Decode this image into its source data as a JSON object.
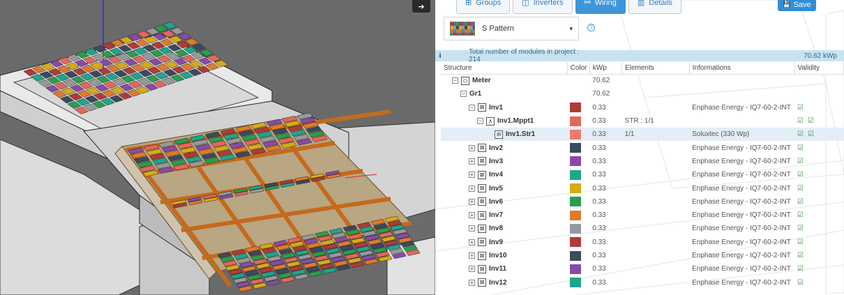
{
  "tabs": [
    {
      "label": "Groups",
      "icon": "groups-icon",
      "glyph": "⊞",
      "active": false
    },
    {
      "label": "Inverters",
      "icon": "inverter-icon",
      "glyph": "◫",
      "active": false
    },
    {
      "label": "Wiring",
      "icon": "wiring-icon",
      "glyph": "⚯",
      "active": true
    },
    {
      "label": "Details",
      "icon": "chart-icon",
      "glyph": "▥",
      "active": false
    }
  ],
  "toolbar": {
    "save_label": "Save",
    "save_icon": "💾"
  },
  "pattern": {
    "label": "S Pattern",
    "help": "?"
  },
  "info": {
    "icon": "i",
    "text": "Total number of modules in project : 214",
    "kwp": "70.62 kWp"
  },
  "columns": [
    "Structure",
    "Color",
    "kWp",
    "Elements",
    "Informations",
    "Validity"
  ],
  "rows": [
    {
      "indent": 1,
      "exp": "⊟",
      "icon": "meter-icon",
      "iconGlyph": "▭",
      "name": "Meter",
      "color": "",
      "kwp": "70.62",
      "elements": "",
      "info": "",
      "valid": 0,
      "sel": false
    },
    {
      "indent": 2,
      "exp": "⊟",
      "icon": "",
      "iconGlyph": "",
      "name": "Gr1",
      "color": "",
      "kwp": "70.62",
      "elements": "",
      "info": "",
      "valid": 0,
      "sel": false
    },
    {
      "indent": 3,
      "exp": "⊟",
      "icon": "inverter-icon",
      "iconGlyph": "⊠",
      "name": "Inv1",
      "color": "#b23a36",
      "kwp": "0.33",
      "elements": "",
      "info": "Enphase Energy - IQ7-60-2-INT",
      "valid": 1,
      "sel": false
    },
    {
      "indent": 4,
      "exp": "⊟",
      "icon": "mppt-icon",
      "iconGlyph": "∧",
      "name": "Inv1.Mppt1",
      "color": "#e5665c",
      "kwp": "0.33",
      "elements": "STR : 1/1",
      "info": "",
      "valid": 2,
      "sel": false
    },
    {
      "indent": 5,
      "exp": "",
      "icon": "string-icon",
      "iconGlyph": "⊞",
      "name": "Inv1.Str1",
      "color": "#ee7b72",
      "kwp": "0.33",
      "elements": "1/1",
      "info": "Soluxtec (330 Wp)",
      "valid": 2,
      "sel": true
    },
    {
      "indent": 3,
      "exp": "⊞",
      "icon": "inverter-icon",
      "iconGlyph": "⊠",
      "name": "Inv2",
      "color": "#3b4a5e",
      "kwp": "0.33",
      "elements": "",
      "info": "Enphase Energy - IQ7-60-2-INT",
      "valid": 1,
      "sel": false
    },
    {
      "indent": 3,
      "exp": "⊞",
      "icon": "inverter-icon",
      "iconGlyph": "⊠",
      "name": "Inv3",
      "color": "#8a4aa8",
      "kwp": "0.33",
      "elements": "",
      "info": "Enphase Energy - IQ7-60-2-INT",
      "valid": 1,
      "sel": false
    },
    {
      "indent": 3,
      "exp": "⊞",
      "icon": "inverter-icon",
      "iconGlyph": "⊠",
      "name": "Inv4",
      "color": "#1fa58e",
      "kwp": "0.33",
      "elements": "",
      "info": "Enphase Energy - IQ7-60-2-INT",
      "valid": 1,
      "sel": false
    },
    {
      "indent": 3,
      "exp": "⊞",
      "icon": "inverter-icon",
      "iconGlyph": "⊠",
      "name": "Inv5",
      "color": "#d8ab12",
      "kwp": "0.33",
      "elements": "",
      "info": "Enphase Energy - IQ7-60-2-INT",
      "valid": 1,
      "sel": false
    },
    {
      "indent": 3,
      "exp": "⊞",
      "icon": "inverter-icon",
      "iconGlyph": "⊠",
      "name": "Inv6",
      "color": "#2a9e4c",
      "kwp": "0.33",
      "elements": "",
      "info": "Enphase Energy - IQ7-60-2-INT",
      "valid": 1,
      "sel": false
    },
    {
      "indent": 3,
      "exp": "⊞",
      "icon": "inverter-icon",
      "iconGlyph": "⊠",
      "name": "Inv7",
      "color": "#e07a2a",
      "kwp": "0.33",
      "elements": "",
      "info": "Enphase Energy - IQ7-60-2-INT",
      "valid": 1,
      "sel": false
    },
    {
      "indent": 3,
      "exp": "⊞",
      "icon": "inverter-icon",
      "iconGlyph": "⊠",
      "name": "Inv8",
      "color": "#969a9b",
      "kwp": "0.33",
      "elements": "",
      "info": "Enphase Energy - IQ7-60-2-INT",
      "valid": 1,
      "sel": false
    },
    {
      "indent": 3,
      "exp": "⊞",
      "icon": "inverter-icon",
      "iconGlyph": "⊠",
      "name": "Inv9",
      "color": "#b23a36",
      "kwp": "0.33",
      "elements": "",
      "info": "Enphase Energy - IQ7-60-2-INT",
      "valid": 1,
      "sel": false
    },
    {
      "indent": 3,
      "exp": "⊞",
      "icon": "inverter-icon",
      "iconGlyph": "⊠",
      "name": "Inv10",
      "color": "#3b4a5e",
      "kwp": "0.33",
      "elements": "",
      "info": "Enphase Energy - IQ7-60-2-INT",
      "valid": 1,
      "sel": false
    },
    {
      "indent": 3,
      "exp": "⊞",
      "icon": "inverter-icon",
      "iconGlyph": "⊠",
      "name": "Inv11",
      "color": "#8a4aa8",
      "kwp": "0.33",
      "elements": "",
      "info": "Enphase Energy - IQ7-60-2-INT",
      "valid": 1,
      "sel": false
    },
    {
      "indent": 3,
      "exp": "⊞",
      "icon": "inverter-icon",
      "iconGlyph": "⊠",
      "name": "Inv12",
      "color": "#1fa58e",
      "kwp": "0.33",
      "elements": "",
      "info": "Enphase Energy - IQ7-60-2-INT",
      "valid": 1,
      "sel": false
    }
  ],
  "viewport": {
    "panel_colors": [
      "#b23a36",
      "#e5665c",
      "#3b4a5e",
      "#8a4aa8",
      "#1fa58e",
      "#d8ab12",
      "#2a9e4c",
      "#e07a2a",
      "#969a9b"
    ],
    "toggle_icon": "arrow-right-icon",
    "toggle_glyph": "➔"
  }
}
